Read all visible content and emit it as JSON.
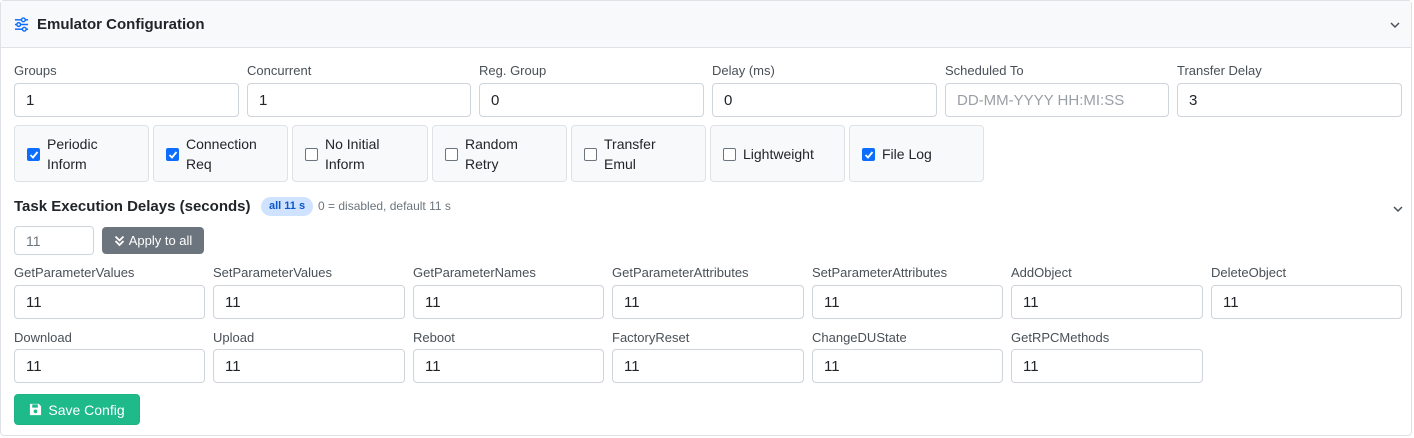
{
  "header": {
    "title": "Emulator Configuration",
    "icon": "sliders-icon",
    "toggle_icon": "chevron-down-icon"
  },
  "fields": [
    {
      "label": "Groups",
      "value": "1",
      "placeholder": ""
    },
    {
      "label": "Concurrent",
      "value": "1",
      "placeholder": ""
    },
    {
      "label": "Reg. Group",
      "value": "0",
      "placeholder": ""
    },
    {
      "label": "Delay (ms)",
      "value": "0",
      "placeholder": ""
    },
    {
      "label": "Scheduled To",
      "value": "",
      "placeholder": "DD-MM-YYYY HH:MI:SS"
    },
    {
      "label": "Transfer Delay",
      "value": "3",
      "placeholder": ""
    }
  ],
  "checkboxes": [
    {
      "label_line1": "Periodic",
      "label_line2": "Inform",
      "checked": true
    },
    {
      "label_line1": "Connection",
      "label_line2": "Req",
      "checked": true
    },
    {
      "label_line1": "No Initial",
      "label_line2": "Inform",
      "checked": false
    },
    {
      "label_line1": "Random",
      "label_line2": "Retry",
      "checked": false
    },
    {
      "label_line1": "Transfer",
      "label_line2": "Emul",
      "checked": false
    },
    {
      "label_line1": "Lightweight",
      "label_line2": "",
      "checked": false
    },
    {
      "label_line1": "File Log",
      "label_line2": "",
      "checked": true
    }
  ],
  "task_delays": {
    "title": "Task Execution Delays (seconds)",
    "badge": "all 11 s",
    "hint": "0 = disabled, default 11 s",
    "apply_value": "11",
    "apply_label": "Apply to all",
    "apply_icon": "double-chevron-down-icon",
    "items": [
      {
        "label": "GetParameterValues",
        "value": "11"
      },
      {
        "label": "SetParameterValues",
        "value": "11"
      },
      {
        "label": "GetParameterNames",
        "value": "11"
      },
      {
        "label": "GetParameterAttributes",
        "value": "11"
      },
      {
        "label": "SetParameterAttributes",
        "value": "11"
      },
      {
        "label": "AddObject",
        "value": "11"
      },
      {
        "label": "DeleteObject",
        "value": "11"
      },
      {
        "label": "Download",
        "value": "11"
      },
      {
        "label": "Upload",
        "value": "11"
      },
      {
        "label": "Reboot",
        "value": "11"
      },
      {
        "label": "FactoryReset",
        "value": "11"
      },
      {
        "label": "ChangeDUState",
        "value": "11"
      },
      {
        "label": "GetRPCMethods",
        "value": "11"
      }
    ]
  },
  "save": {
    "label": "Save Config",
    "icon": "floppy-disk-icon"
  },
  "colors": {
    "primary": "#0d6efd",
    "secondary": "#6c757d",
    "success": "#1fba8a",
    "badge_bg": "#cfe2ff"
  }
}
